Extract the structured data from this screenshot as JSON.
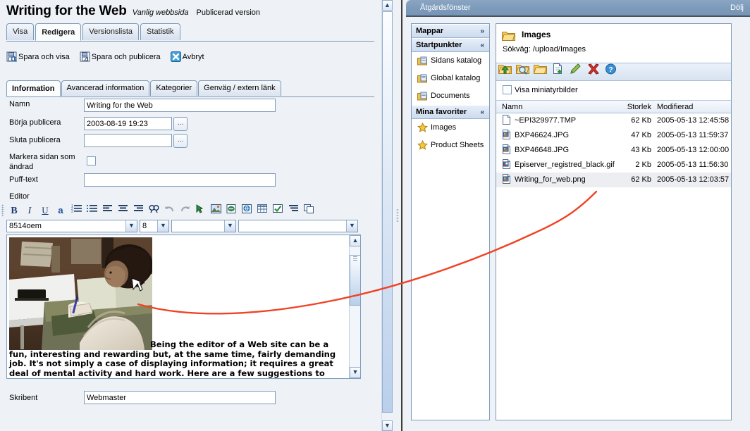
{
  "editor_window": {
    "page_title": "Writing for the Web",
    "page_type": "Vanlig webbsida",
    "page_state": "Publicerad version",
    "main_tabs": [
      {
        "label": "Visa",
        "active": false
      },
      {
        "label": "Redigera",
        "active": true
      },
      {
        "label": "Versionslista",
        "active": false
      },
      {
        "label": "Statistik",
        "active": false
      }
    ],
    "actions": [
      {
        "label": "Spara och visa",
        "icon": "save-and-view-icon"
      },
      {
        "label": "Spara och publicera",
        "icon": "save-and-publish-icon"
      },
      {
        "label": "Avbryt",
        "icon": "cancel-icon"
      }
    ],
    "inner_tabs": [
      {
        "label": "Information",
        "active": true
      },
      {
        "label": "Avancerad information",
        "active": false
      },
      {
        "label": "Kategorier",
        "active": false
      },
      {
        "label": "Genväg / extern länk",
        "active": false
      }
    ],
    "form": {
      "name_label": "Namn",
      "name_value": "Writing for the Web",
      "start_publish_label": "Börja publicera",
      "start_publish_value": "2003-08-19 19:23",
      "stop_publish_label": "Sluta publicera",
      "stop_publish_value": "",
      "mark_changed_label_line1": "Markera sidan som",
      "mark_changed_label_line2": "ändrad",
      "mark_changed_checked": false,
      "teaser_label": "Puff-text",
      "teaser_value": "",
      "editor_label": "Editor",
      "author_label": "Skribent",
      "author_value": "Webmaster",
      "browse_button_label": "..."
    },
    "editor_toolbar": {
      "buttons": [
        {
          "name": "bold-icon",
          "glyph": "B"
        },
        {
          "name": "italic-icon",
          "glyph": "I"
        },
        {
          "name": "underline-icon",
          "glyph": "U"
        },
        {
          "name": "font-color-icon",
          "glyph": "a"
        },
        {
          "name": "ordered-list-icon",
          "glyph": ""
        },
        {
          "name": "bullet-list-icon",
          "glyph": ""
        },
        {
          "name": "align-left-icon",
          "glyph": ""
        },
        {
          "name": "align-center-icon",
          "glyph": ""
        },
        {
          "name": "align-right-icon",
          "glyph": ""
        },
        {
          "name": "find-icon",
          "glyph": ""
        },
        {
          "name": "undo-icon",
          "glyph": ""
        },
        {
          "name": "redo-icon",
          "glyph": ""
        },
        {
          "name": "insert-link-icon",
          "glyph": ""
        },
        {
          "name": "insert-image-icon",
          "glyph": ""
        },
        {
          "name": "insert-document-icon",
          "glyph": ""
        },
        {
          "name": "insert-hyperlink-icon",
          "glyph": ""
        },
        {
          "name": "insert-table-icon",
          "glyph": ""
        },
        {
          "name": "spellcheck-icon",
          "glyph": ""
        },
        {
          "name": "indent-icon",
          "glyph": ""
        },
        {
          "name": "copy-icon",
          "glyph": ""
        }
      ],
      "font_family": "8514oem",
      "font_size": "8",
      "style_select": "",
      "format_select": ""
    },
    "editor_content": {
      "image_name": "writing-for-web-photo",
      "body_text": "Being the editor of a Web site can be a fun, interesting and rewarding but, at the same time, fairly demanding job. It's not simply a case of displaying information; it requires a great deal of mental activity and hard work. Here are a few suggestions to help you to create a good, content-"
    }
  },
  "action_window": {
    "title": "Åtgärdsfönster",
    "hide_label": "Dölj",
    "tree": {
      "sections": [
        {
          "label": "Mappar",
          "chevron": "»",
          "collapsed": true,
          "items": []
        },
        {
          "label": "Startpunkter",
          "chevron": "«",
          "collapsed": false,
          "items": [
            {
              "label": "Sidans katalog",
              "icon": "folder-catalog-icon"
            },
            {
              "label": "Global katalog",
              "icon": "folder-catalog-icon"
            },
            {
              "label": "Documents",
              "icon": "folder-catalog-icon"
            }
          ]
        },
        {
          "label": "Mina favoriter",
          "chevron": "«",
          "collapsed": false,
          "items": [
            {
              "label": "Images",
              "icon": "star-icon"
            },
            {
              "label": "Product Sheets",
              "icon": "star-icon"
            }
          ]
        }
      ]
    },
    "file_panel": {
      "folder_name": "Images",
      "path_label": "Sökväg:",
      "path_value": "/upload/Images",
      "toolbar": [
        {
          "name": "folder-up-icon"
        },
        {
          "name": "folder-refresh-icon"
        },
        {
          "name": "new-folder-icon"
        },
        {
          "name": "new-file-icon"
        },
        {
          "name": "rename-icon"
        },
        {
          "name": "delete-icon"
        },
        {
          "name": "help-icon"
        }
      ],
      "show_thumbnails_label": "Visa miniatyrbilder",
      "show_thumbnails_checked": false,
      "columns": [
        "Namn",
        "Storlek",
        "Modifierad"
      ],
      "files": [
        {
          "name": "~EPI329977.TMP",
          "size": "62 Kb",
          "modified": "2005-05-13 12:45:58",
          "icon": "generic-file-icon",
          "selected": false
        },
        {
          "name": "BXP46624.JPG",
          "size": "47 Kb",
          "modified": "2005-05-13 11:59:37",
          "icon": "image-file-icon",
          "selected": false
        },
        {
          "name": "BXP46648.JPG",
          "size": "43 Kb",
          "modified": "2005-05-13 12:00:00",
          "icon": "image-file-icon",
          "selected": false
        },
        {
          "name": "Episerver_registred_black.gif",
          "size": "2 Kb",
          "modified": "2005-05-13 11:56:30",
          "icon": "gif-file-icon",
          "selected": false
        },
        {
          "name": "Writing_for_web.png",
          "size": "62 Kb",
          "modified": "2005-05-13 12:03:57",
          "icon": "image-file-icon",
          "selected": true
        }
      ]
    }
  },
  "annotation": {
    "color": "#f04323",
    "name": "drag-drop-arrow"
  }
}
